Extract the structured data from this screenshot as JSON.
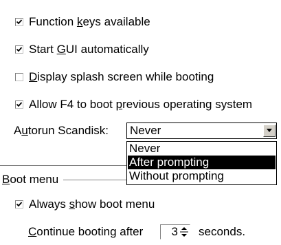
{
  "options": {
    "function_keys": {
      "checked": true,
      "pre": "Function ",
      "ul": "k",
      "post": "eys available"
    },
    "start_gui": {
      "checked": true,
      "pre": "Start ",
      "ul": "G",
      "post": "UI automatically"
    },
    "splash_screen": {
      "checked": false,
      "pre": "",
      "ul": "D",
      "post": "isplay splash screen while booting"
    },
    "allow_f4": {
      "checked": true,
      "pre": "Allow F4 to boot ",
      "ul": "p",
      "post": "revious operating system"
    }
  },
  "autorun": {
    "label_pre": "A",
    "label_ul": "u",
    "label_post": "torun Scandisk:",
    "value": "Never",
    "options": [
      "Never",
      "After prompting",
      "Without prompting"
    ],
    "highlighted": "After prompting"
  },
  "boot_menu": {
    "title_ul": "B",
    "title_post": "oot menu",
    "always_show": {
      "checked": true,
      "pre": "Always ",
      "ul": "s",
      "post": "how boot menu"
    },
    "continue_pre": "",
    "continue_ul": "C",
    "continue_post": "ontinue booting after",
    "seconds_value": "3",
    "seconds_label": "seconds."
  },
  "colors": {
    "highlight_bg": "#000000",
    "highlight_fg": "#ffffff",
    "button_face": "#d4d0c8"
  }
}
